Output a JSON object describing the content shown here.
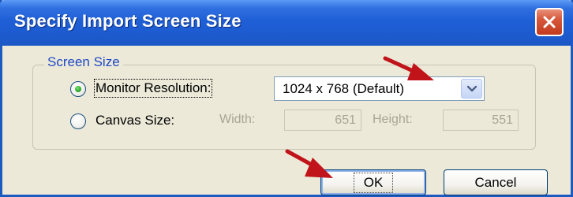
{
  "dialog": {
    "title": "Specify Import Screen Size"
  },
  "group": {
    "legend": "Screen Size"
  },
  "options": {
    "monitor": {
      "label": "Monitor Resolution:",
      "selected": true,
      "resolution_value": "1024 x 768 (Default)"
    },
    "canvas": {
      "label": "Canvas Size:",
      "selected": false,
      "width_label": "Width:",
      "width_value": "651",
      "height_label": "Height:",
      "height_value": "551"
    }
  },
  "buttons": {
    "ok": "OK",
    "cancel": "Cancel"
  },
  "colors": {
    "titlebar": "#1d5bd0",
    "dialog_bg": "#ece9d8",
    "annotation_arrow": "#c0141a"
  }
}
